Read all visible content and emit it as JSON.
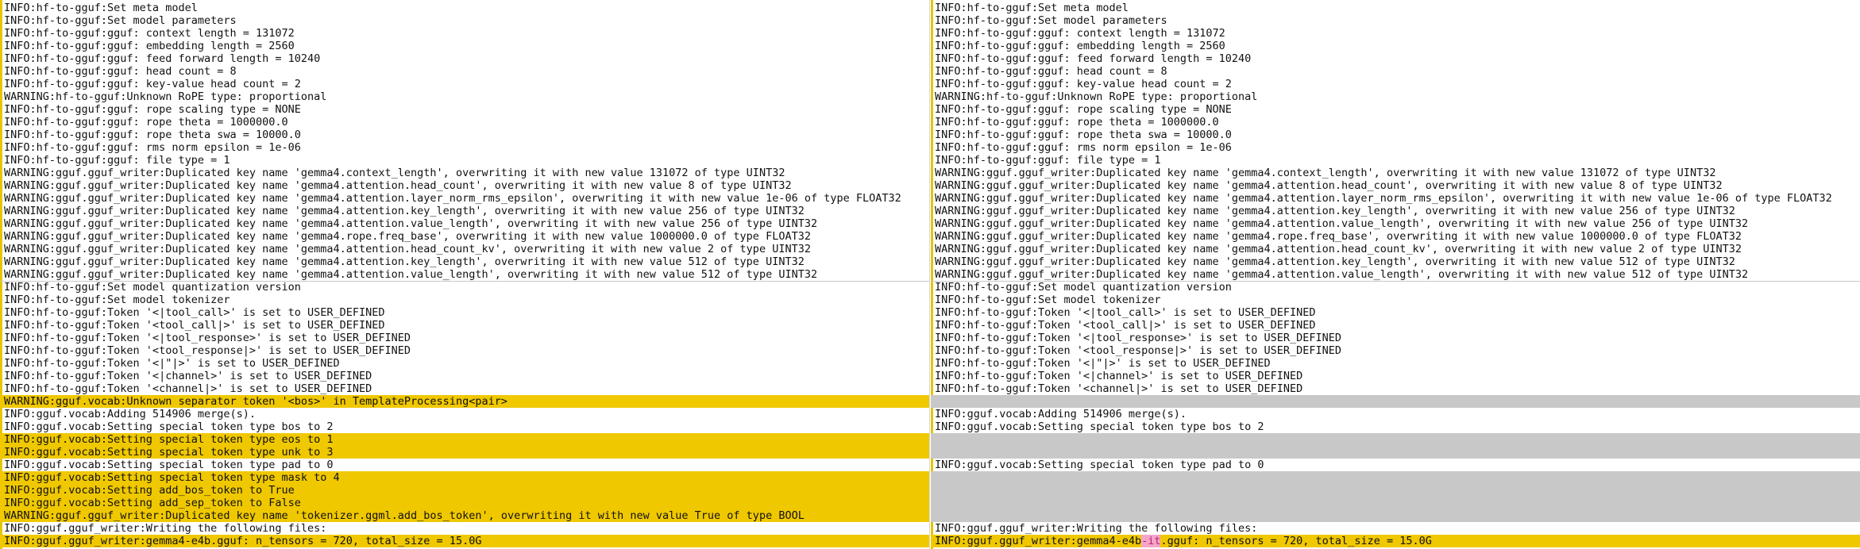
{
  "left_pane": {
    "lines": [
      {
        "text": "INFO:hf-to-gguf:Set meta model"
      },
      {
        "text": "INFO:hf-to-gguf:Set model parameters"
      },
      {
        "text": "INFO:hf-to-gguf:gguf: context length = 131072"
      },
      {
        "text": "INFO:hf-to-gguf:gguf: embedding length = 2560"
      },
      {
        "text": "INFO:hf-to-gguf:gguf: feed forward length = 10240"
      },
      {
        "text": "INFO:hf-to-gguf:gguf: head count = 8"
      },
      {
        "text": "INFO:hf-to-gguf:gguf: key-value head count = 2"
      },
      {
        "text": "WARNING:hf-to-gguf:Unknown RoPE type: proportional"
      },
      {
        "text": "INFO:hf-to-gguf:gguf: rope scaling type = NONE"
      },
      {
        "text": "INFO:hf-to-gguf:gguf: rope theta = 1000000.0"
      },
      {
        "text": "INFO:hf-to-gguf:gguf: rope theta swa = 10000.0"
      },
      {
        "text": "INFO:hf-to-gguf:gguf: rms norm epsilon = 1e-06"
      },
      {
        "text": "INFO:hf-to-gguf:gguf: file type = 1"
      },
      {
        "text": "WARNING:gguf.gguf_writer:Duplicated key name 'gemma4.context_length', overwriting it with new value 131072 of type UINT32"
      },
      {
        "text": "WARNING:gguf.gguf_writer:Duplicated key name 'gemma4.attention.head_count', overwriting it with new value 8 of type UINT32"
      },
      {
        "text": "WARNING:gguf.gguf_writer:Duplicated key name 'gemma4.attention.layer_norm_rms_epsilon', overwriting it with new value 1e-06 of type FLOAT32"
      },
      {
        "text": "WARNING:gguf.gguf_writer:Duplicated key name 'gemma4.attention.key_length', overwriting it with new value 256 of type UINT32"
      },
      {
        "text": "WARNING:gguf.gguf_writer:Duplicated key name 'gemma4.attention.value_length', overwriting it with new value 256 of type UINT32"
      },
      {
        "text": "WARNING:gguf.gguf_writer:Duplicated key name 'gemma4.rope.freq_base', overwriting it with new value 1000000.0 of type FLOAT32"
      },
      {
        "text": "WARNING:gguf.gguf_writer:Duplicated key name 'gemma4.attention.head_count_kv', overwriting it with new value 2 of type UINT32"
      },
      {
        "text": "WARNING:gguf.gguf_writer:Duplicated key name 'gemma4.attention.key_length', overwriting it with new value 512 of type UINT32"
      },
      {
        "text": "WARNING:gguf.gguf_writer:Duplicated key name 'gemma4.attention.value_length', overwriting it with new value 512 of type UINT32"
      },
      {
        "text": "INFO:hf-to-gguf:Set model quantization version",
        "sep": true
      },
      {
        "text": "INFO:hf-to-gguf:Set model tokenizer"
      },
      {
        "text": "INFO:hf-to-gguf:Token '<|tool_call>' is set to USER_DEFINED"
      },
      {
        "text": "INFO:hf-to-gguf:Token '<tool_call|>' is set to USER_DEFINED"
      },
      {
        "text": "INFO:hf-to-gguf:Token '<|tool_response>' is set to USER_DEFINED"
      },
      {
        "text": "INFO:hf-to-gguf:Token '<tool_response|>' is set to USER_DEFINED"
      },
      {
        "text": "INFO:hf-to-gguf:Token '<|\"|>' is set to USER_DEFINED"
      },
      {
        "text": "INFO:hf-to-gguf:Token '<|channel>' is set to USER_DEFINED"
      },
      {
        "text": "INFO:hf-to-gguf:Token '<channel|>' is set to USER_DEFINED"
      },
      {
        "text": "WARNING:gguf.vocab:Unknown separator token '<bos>' in TemplateProcessing<pair>",
        "hl": true
      },
      {
        "text": "INFO:gguf.vocab:Adding 514906 merge(s)."
      },
      {
        "text": "INFO:gguf.vocab:Setting special token type bos to 2"
      },
      {
        "text": "INFO:gguf.vocab:Setting special token type eos to 1",
        "hl": true
      },
      {
        "text": "INFO:gguf.vocab:Setting special token type unk to 3",
        "hl": true
      },
      {
        "text": "INFO:gguf.vocab:Setting special token type pad to 0"
      },
      {
        "text": "INFO:gguf.vocab:Setting special token type mask to 4",
        "hl": true
      },
      {
        "text": "INFO:gguf.vocab:Setting add_bos_token to True",
        "hl": true
      },
      {
        "text": "INFO:gguf.vocab:Setting add_sep_token to False",
        "hl": true
      },
      {
        "text": "WARNING:gguf.gguf_writer:Duplicated key name 'tokenizer.ggml.add_bos_token', overwriting it with new value True of type BOOL",
        "hl": true
      },
      {
        "text": "INFO:gguf.gguf_writer:Writing the following files:"
      },
      {
        "text": "INFO:gguf.gguf_writer:gemma4-e4b.gguf: n_tensors = 720, total_size = 15.0G",
        "hl": true
      }
    ]
  },
  "right_pane": {
    "lines": [
      {
        "text": "INFO:hf-to-gguf:Set meta model"
      },
      {
        "text": "INFO:hf-to-gguf:Set model parameters"
      },
      {
        "text": "INFO:hf-to-gguf:gguf: context length = 131072"
      },
      {
        "text": "INFO:hf-to-gguf:gguf: embedding length = 2560"
      },
      {
        "text": "INFO:hf-to-gguf:gguf: feed forward length = 10240"
      },
      {
        "text": "INFO:hf-to-gguf:gguf: head count = 8"
      },
      {
        "text": "INFO:hf-to-gguf:gguf: key-value head count = 2"
      },
      {
        "text": "WARNING:hf-to-gguf:Unknown RoPE type: proportional"
      },
      {
        "text": "INFO:hf-to-gguf:gguf: rope scaling type = NONE"
      },
      {
        "text": "INFO:hf-to-gguf:gguf: rope theta = 1000000.0"
      },
      {
        "text": "INFO:hf-to-gguf:gguf: rope theta swa = 10000.0"
      },
      {
        "text": "INFO:hf-to-gguf:gguf: rms norm epsilon = 1e-06"
      },
      {
        "text": "INFO:hf-to-gguf:gguf: file type = 1"
      },
      {
        "text": "WARNING:gguf.gguf_writer:Duplicated key name 'gemma4.context_length', overwriting it with new value 131072 of type UINT32"
      },
      {
        "text": "WARNING:gguf.gguf_writer:Duplicated key name 'gemma4.attention.head_count', overwriting it with new value 8 of type UINT32"
      },
      {
        "text": "WARNING:gguf.gguf_writer:Duplicated key name 'gemma4.attention.layer_norm_rms_epsilon', overwriting it with new value 1e-06 of type FLOAT32"
      },
      {
        "text": "WARNING:gguf.gguf_writer:Duplicated key name 'gemma4.attention.key_length', overwriting it with new value 256 of type UINT32"
      },
      {
        "text": "WARNING:gguf.gguf_writer:Duplicated key name 'gemma4.attention.value_length', overwriting it with new value 256 of type UINT32"
      },
      {
        "text": "WARNING:gguf.gguf_writer:Duplicated key name 'gemma4.rope.freq_base', overwriting it with new value 1000000.0 of type FLOAT32"
      },
      {
        "text": "WARNING:gguf.gguf_writer:Duplicated key name 'gemma4.attention.head_count_kv', overwriting it with new value 2 of type UINT32"
      },
      {
        "text": "WARNING:gguf.gguf_writer:Duplicated key name 'gemma4.attention.key_length', overwriting it with new value 512 of type UINT32"
      },
      {
        "text": "WARNING:gguf.gguf_writer:Duplicated key name 'gemma4.attention.value_length', overwriting it with new value 512 of type UINT32"
      },
      {
        "text": "INFO:hf-to-gguf:Set model quantization version",
        "sep": true
      },
      {
        "text": "INFO:hf-to-gguf:Set model tokenizer"
      },
      {
        "text": "INFO:hf-to-gguf:Token '<|tool_call>' is set to USER_DEFINED"
      },
      {
        "text": "INFO:hf-to-gguf:Token '<tool_call|>' is set to USER_DEFINED"
      },
      {
        "text": "INFO:hf-to-gguf:Token '<|tool_response>' is set to USER_DEFINED"
      },
      {
        "text": "INFO:hf-to-gguf:Token '<tool_response|>' is set to USER_DEFINED"
      },
      {
        "text": "INFO:hf-to-gguf:Token '<|\"|>' is set to USER_DEFINED"
      },
      {
        "text": "INFO:hf-to-gguf:Token '<|channel>' is set to USER_DEFINED"
      },
      {
        "text": "INFO:hf-to-gguf:Token '<channel|>' is set to USER_DEFINED"
      },
      {
        "text": "",
        "blank": true
      },
      {
        "text": "INFO:gguf.vocab:Adding 514906 merge(s)."
      },
      {
        "text": "INFO:gguf.vocab:Setting special token type bos to 2"
      },
      {
        "text": "",
        "blank": true
      },
      {
        "text": "",
        "blank": true
      },
      {
        "text": "INFO:gguf.vocab:Setting special token type pad to 0"
      },
      {
        "text": "",
        "blank": true
      },
      {
        "text": "",
        "blank": true
      },
      {
        "text": "",
        "blank": true
      },
      {
        "text": "",
        "blank": true
      },
      {
        "text": "INFO:gguf.gguf_writer:Writing the following files:"
      },
      {
        "text": "INFO:gguf.gguf_writer:gemma4-e4b-it.gguf: n_tensors = 720, total_size = 15.0G",
        "hl": true,
        "diff_prefix": "INFO:gguf.gguf_writer:gemma4-e4b",
        "diff_word": "-it",
        "diff_suffix": ".gguf: n_tensors = 720, total_size = 15.0G"
      }
    ]
  },
  "colors": {
    "changed_line": "#f0c800",
    "missing_line": "#c8c8c8",
    "inline_diff": "#f4a6c8"
  }
}
